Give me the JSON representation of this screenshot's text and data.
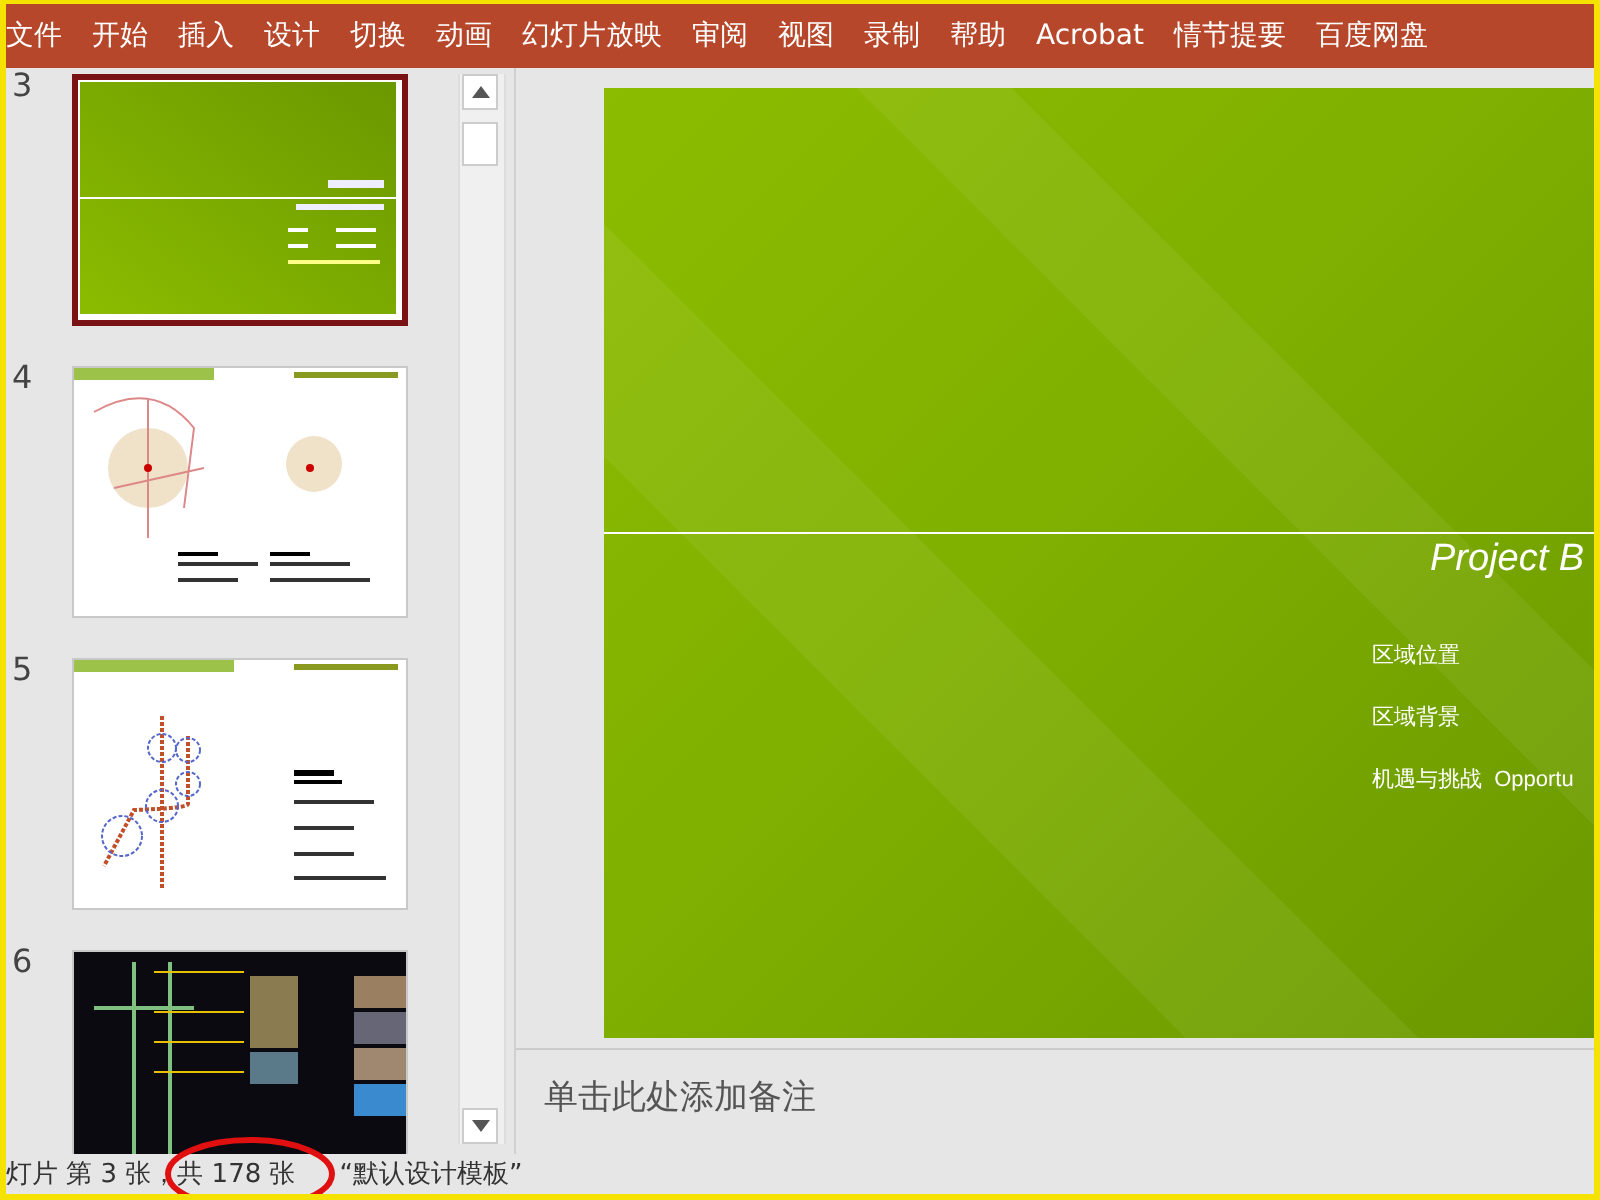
{
  "menu": [
    {
      "label": "文件"
    },
    {
      "label": "开始"
    },
    {
      "label": "插入"
    },
    {
      "label": "设计"
    },
    {
      "label": "切换"
    },
    {
      "label": "动画"
    },
    {
      "label": "幻灯片放映"
    },
    {
      "label": "审阅"
    },
    {
      "label": "视图"
    },
    {
      "label": "录制"
    },
    {
      "label": "帮助"
    },
    {
      "label": "Acrobat"
    },
    {
      "label": "情节提要"
    },
    {
      "label": "百度网盘"
    }
  ],
  "slides": [
    {
      "number": "3",
      "kind": "title",
      "selected": true
    },
    {
      "number": "4",
      "kind": "map",
      "selected": false
    },
    {
      "number": "5",
      "kind": "diagram",
      "selected": false
    },
    {
      "number": "6",
      "kind": "photos",
      "selected": false
    }
  ],
  "slide": {
    "title": "Project B",
    "items": [
      "区域位置",
      "区域背景",
      "机遇与挑战  Opportu"
    ]
  },
  "notes": {
    "placeholder": "单击此处添加备注"
  },
  "status_bar": {
    "slide_info": "灯片 第 3 张，共 178 张",
    "theme": "“默认设计模板”"
  }
}
